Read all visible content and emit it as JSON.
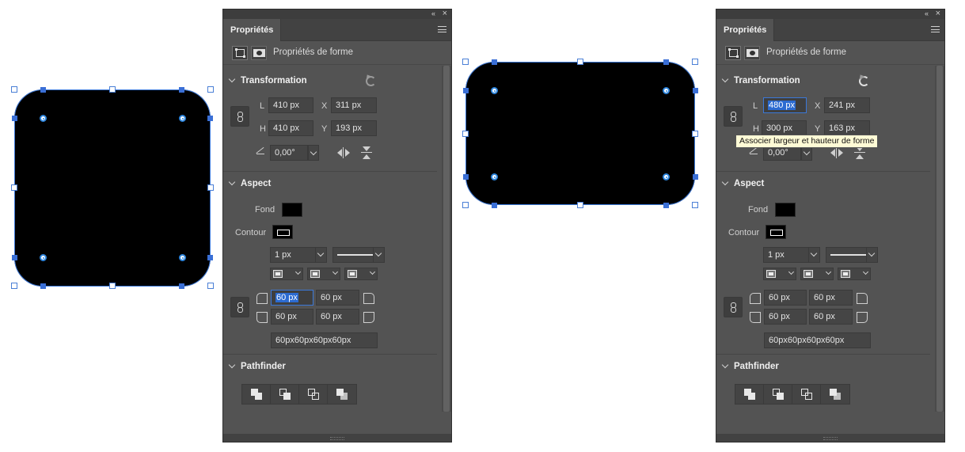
{
  "panel": {
    "tab_label": "Propriétés",
    "shape_properties_label": "Propriétés de forme",
    "transformation_title": "Transformation",
    "aspect_title": "Aspect",
    "pathfinder_title": "Pathfinder",
    "labels": {
      "w": "L",
      "h": "H",
      "x": "X",
      "y": "Y",
      "fill": "Fond",
      "stroke": "Contour"
    },
    "angle_value": "0,00°",
    "stroke_width": "1 px",
    "corner_summary": "60px60px60px60px"
  },
  "left_panel": {
    "width": "410 px",
    "height": "410 px",
    "x": "311 px",
    "y": "193 px",
    "corner_tl": "60 px",
    "corner_tr": "60 px",
    "corner_bl": "60 px",
    "corner_br": "60 px"
  },
  "right_panel": {
    "width": "480 px",
    "height": "300 px",
    "x": "241 px",
    "y": "163 px",
    "corner_tl": "60 px",
    "corner_tr": "60 px",
    "corner_bl": "60 px",
    "corner_br": "60 px",
    "tooltip": "Associer largeur et hauteur de forme"
  },
  "icons": {
    "collapse": "«",
    "close": "×"
  },
  "colors": {
    "selection": "#3b78d8",
    "panel_bg": "#535353",
    "fill": "#000000"
  }
}
